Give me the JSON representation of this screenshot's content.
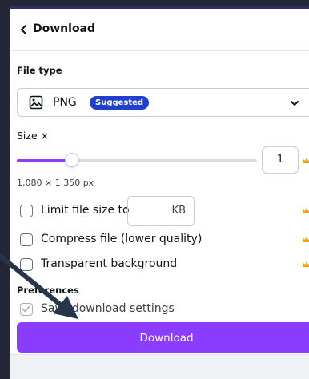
{
  "header": {
    "title": "Download"
  },
  "file_type": {
    "label": "File type",
    "value": "PNG",
    "badge": "Suggested"
  },
  "size": {
    "label": "Size ×",
    "value": "1",
    "slider_fraction": 0.23,
    "dimensions": "1,080 × 1,350 px"
  },
  "options": {
    "limit_size_label": "Limit file size to",
    "kb_unit": "KB",
    "compress_label": "Compress file (lower quality)",
    "transparent_label": "Transparent background"
  },
  "preferences": {
    "label": "Preferences",
    "save_label": "Save download settings"
  },
  "download_button": "Download",
  "colors": {
    "accent": "#8b3dff",
    "badge": "#1f3fd1",
    "crown": "#f2a30f"
  }
}
